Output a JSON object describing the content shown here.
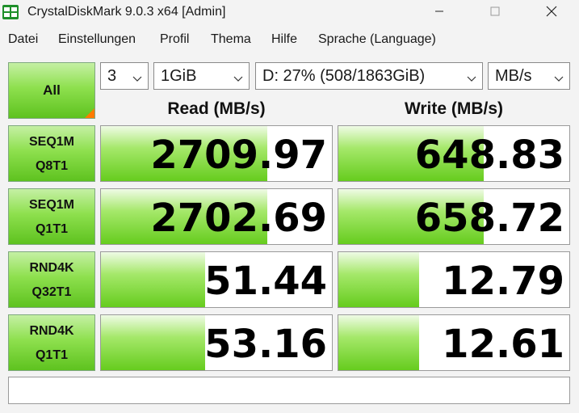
{
  "window": {
    "title": "CrystalDiskMark 9.0.3 x64 [Admin]"
  },
  "icons": {
    "app": "crystaldiskmark-icon",
    "minimize": "minimize-icon",
    "maximize": "maximize-icon",
    "close": "close-icon",
    "dropdown": "chevron-down-icon"
  },
  "menu": [
    "Datei",
    "Einstellungen",
    "Profil",
    "Thema",
    "Hilfe",
    "Sprache (Language)"
  ],
  "controls": {
    "all_label": "All",
    "count": "3",
    "size": "1GiB",
    "drive": "D: 27% (508/1863GiB)",
    "unit": "MB/s"
  },
  "headers": {
    "read": "Read (MB/s)",
    "write": "Write (MB/s)"
  },
  "rows": [
    {
      "l1": "SEQ1M",
      "l2": "Q8T1",
      "read": "2709.97",
      "write": "648.83",
      "read_fill": 0.72,
      "write_fill": 0.63
    },
    {
      "l1": "SEQ1M",
      "l2": "Q1T1",
      "read": "2702.69",
      "write": "658.72",
      "read_fill": 0.72,
      "write_fill": 0.63
    },
    {
      "l1": "RND4K",
      "l2": "Q32T1",
      "read": "51.44",
      "write": "12.79",
      "read_fill": 0.45,
      "write_fill": 0.35
    },
    {
      "l1": "RND4K",
      "l2": "Q1T1",
      "read": "53.16",
      "write": "12.61",
      "read_fill": 0.45,
      "write_fill": 0.35
    }
  ],
  "status_text": "",
  "colors": {
    "accent_green": "#66cc1e",
    "corner_orange": "#ff7a00"
  }
}
